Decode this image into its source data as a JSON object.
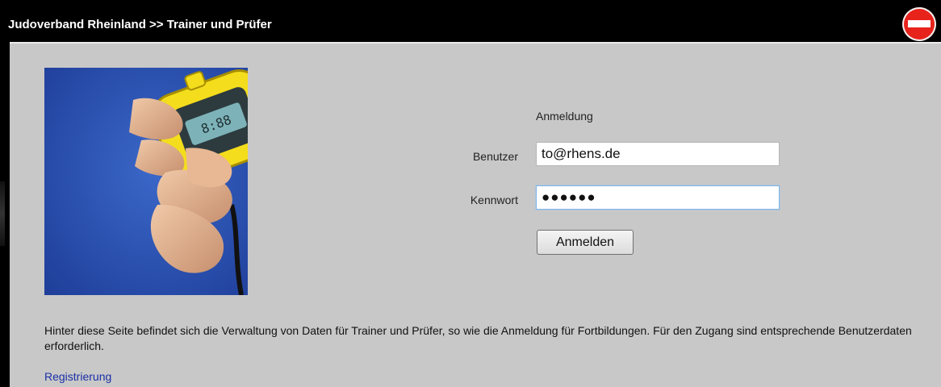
{
  "header": {
    "title": "Judoverband Rheinland >> Trainer und Prüfer",
    "stop_icon": "stop-icon",
    "colors": {
      "bar": "#000000",
      "stop": "#e8231c"
    }
  },
  "login": {
    "heading": "Anmeldung",
    "user_label": "Benutzer",
    "user_value": "to@rhens.de",
    "password_label": "Kennwort",
    "password_value": "●●●●●●",
    "submit_label": "Anmelden"
  },
  "info": {
    "text": "Hinter diese Seite befindet sich die Verwaltung von Daten für Trainer und Prüfer, so wie die Anmeldung für Fortbildungen. Für den Zugang sind entsprechende Benutzerdaten erforderlich.",
    "register_link": "Registrierung"
  },
  "image": {
    "subject": "hand-holding-stopwatch"
  },
  "colors": {
    "panel": "#c8c8c8",
    "link": "#1b2fa6"
  }
}
